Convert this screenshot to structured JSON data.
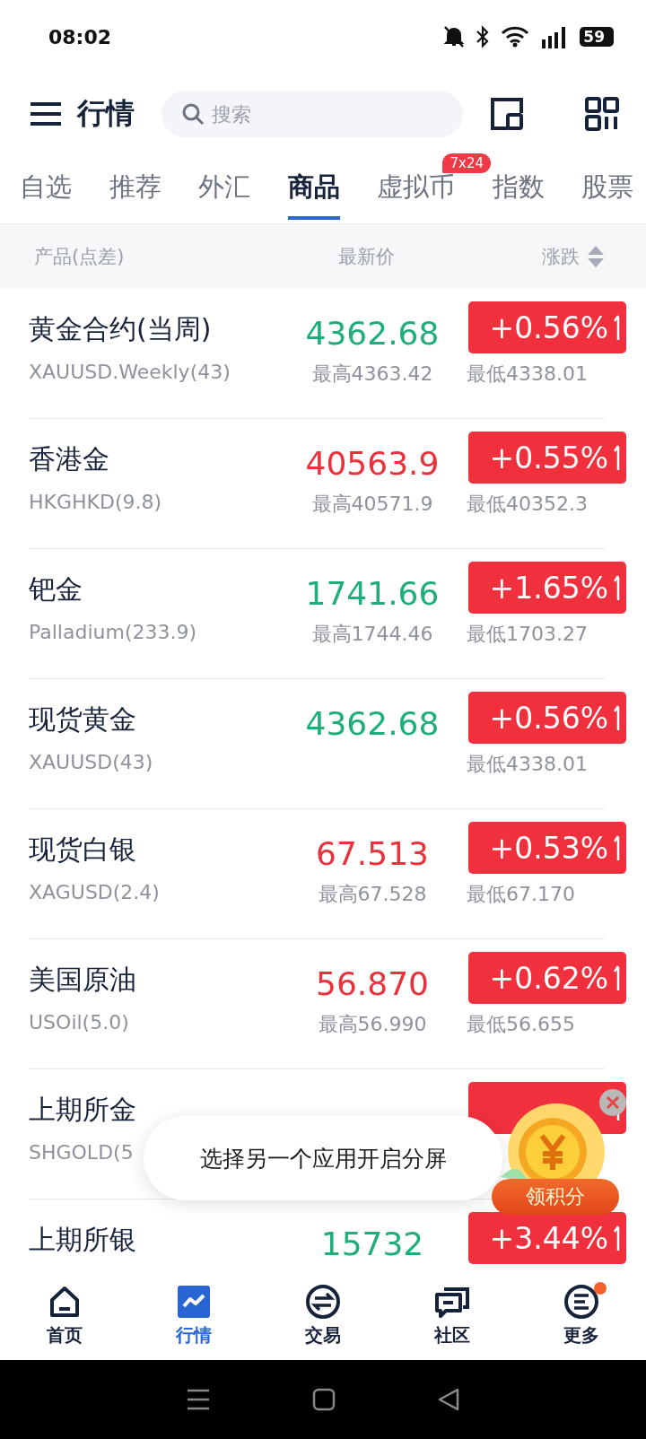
{
  "status_bar": {
    "time": "08:02",
    "battery": "59"
  },
  "header": {
    "title": "行情",
    "search": {
      "placeholder": "搜索"
    }
  },
  "tabs": [
    {
      "label": "自选",
      "selected": false
    },
    {
      "label": "推荐",
      "selected": false
    },
    {
      "label": "外汇",
      "selected": false
    },
    {
      "label": "商品",
      "selected": true
    },
    {
      "label": "虚拟币",
      "selected": false,
      "badge": "7x24"
    },
    {
      "label": "指数",
      "selected": false
    },
    {
      "label": "股票",
      "selected": false
    }
  ],
  "columns": [
    "产品(点差)",
    "最新价",
    "涨跌"
  ],
  "rows": [
    {
      "name": "黄金合约(当周)",
      "code": "XAUUSD.Weekly(43)",
      "price": "4362.68",
      "color": "#1fae79",
      "change": "+0.56%",
      "high": "最高4363.42",
      "low": "最低4338.01"
    },
    {
      "name": "香港金",
      "code": "HKGHKD(9.8)",
      "price": "40563.9",
      "color": "#e8323c",
      "change": "+0.55%",
      "high": "最高40571.9",
      "low": "最低40352.3"
    },
    {
      "name": "钯金",
      "code": "Palladium(233.9)",
      "price": "1741.66",
      "color": "#1fae79",
      "change": "+1.65%",
      "high": "最高1744.46",
      "low": "最低1703.27"
    },
    {
      "name": "现货黄金",
      "code": "XAUUSD(43)",
      "price": "4362.68",
      "color": "#1fae79",
      "change": "+0.56%",
      "low": "最低4338.01"
    },
    {
      "name": "现货白银",
      "code": "XAGUSD(2.4)",
      "price": "67.513",
      "color": "#e8323c",
      "change": "+0.53%",
      "high": "最高67.528",
      "low": "最低67.170"
    },
    {
      "name": "美国原油",
      "code": "USOil(5.0)",
      "price": "56.870",
      "color": "#e8323c",
      "change": "+0.62%",
      "high": "最高56.990",
      "low": "最低56.655"
    },
    {
      "name": "上期所金",
      "code": "SHGOLD(5"
    },
    {
      "name": "上期所银",
      "price": "15732",
      "color": "#1fae79",
      "change": "+3.44%"
    }
  ],
  "toast": "选择另一个应用开启分屏",
  "promo": {
    "label": "领积分"
  },
  "bottom_nav": [
    {
      "label": "首页",
      "kind": "home",
      "selected": false,
      "dot": false
    },
    {
      "label": "行情",
      "kind": "market",
      "selected": true,
      "dot": false
    },
    {
      "label": "交易",
      "kind": "trade",
      "selected": false,
      "dot": false
    },
    {
      "label": "社区",
      "kind": "community",
      "selected": false,
      "dot": false
    },
    {
      "label": "更多",
      "kind": "more",
      "selected": false,
      "dot": true
    }
  ]
}
